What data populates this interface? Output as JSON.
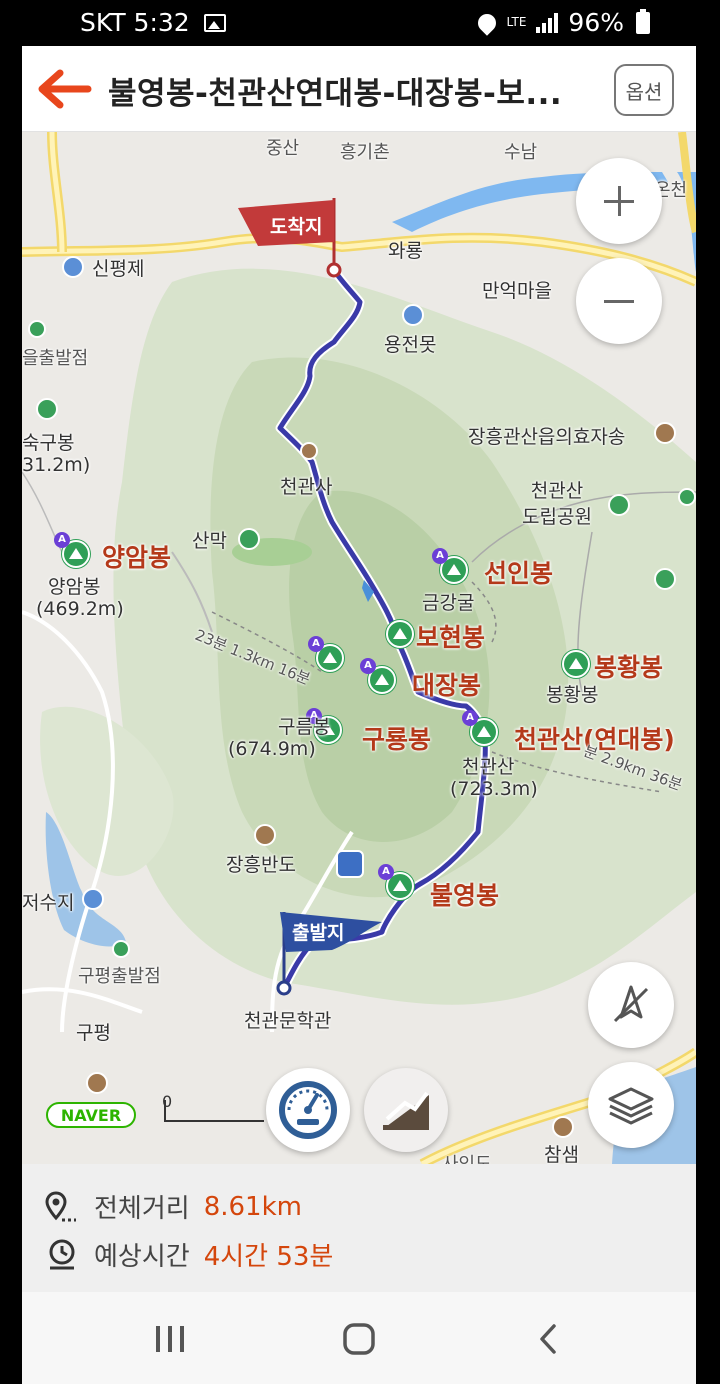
{
  "status_bar": {
    "carrier_time": "SKT 5:32",
    "network": "LTE",
    "battery": "96%"
  },
  "header": {
    "title": "불영봉-천관산연대봉-대장봉-보...",
    "options_label": "옵션",
    "accent_color": "#e8461c"
  },
  "map": {
    "flags": {
      "end": "도착지",
      "start": "출발지"
    },
    "labels": {
      "jungsan": "중산",
      "heunggichon": "흥기촌",
      "sunam": "수남",
      "oncheon": "온천",
      "wallyong": "와룡",
      "sinpyeongje": "신평제",
      "maneok": "만억마을",
      "yongjeonmot": "용전못",
      "eulchul": "을출발점",
      "sukgubong": "숙구봉",
      "sukgubong_elev": "31.2m)",
      "jangheung_temple": "장흥관산읍의효자송",
      "cheongwansa": "천관사",
      "cheongwansan_park": "천관산\n도립공원",
      "sanmak": "산막",
      "yangambong": "양암봉",
      "yangambong_small": "양암봉",
      "yangambong_elev": "(469.2m)",
      "seoninbong": "선인봉",
      "geumganggul": "금강굴",
      "trail_left": "23분 1.3km 16분",
      "bohyeonbong": "보현봉",
      "daejangbong": "대장봉",
      "bonghwangbong": "봉황봉",
      "bonghwangbong_small": "봉황봉",
      "gureumbong": "구름봉",
      "gureumbong_elev": "(674.9m)",
      "guryongbong": "구룡봉",
      "cheongwansan_yeondae": "천관산(연대봉)",
      "cheongwansan_small": "천관산",
      "cheongwansan_elev": "(723.3m)",
      "trail_right": "분 2.9km 36분",
      "jangheung_bando": "장흥반도",
      "bulyeongbong": "불영봉",
      "jeosuji": "저수지",
      "gupyeong_start": "구평출발점",
      "gupyeong": "구평",
      "munhakgwan": "천관문학관",
      "chamsaem": "참샘",
      "sainidong": "사인도"
    },
    "naver_badge": "NAVER",
    "scale_zero": "0",
    "route_color": "#3a3aa8"
  },
  "summary": {
    "distance_label": "전체거리",
    "distance_value": "8.61km",
    "time_label": "예상시간",
    "time_value": "4시간 53분"
  }
}
